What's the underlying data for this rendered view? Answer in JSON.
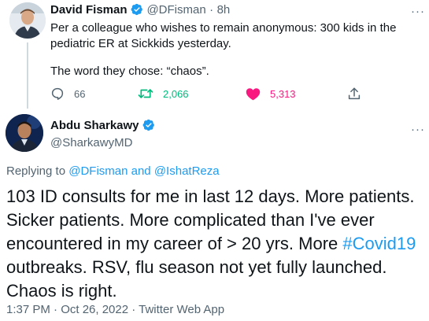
{
  "parent_tweet": {
    "display_name": "David Fisman",
    "handle": "@DFisman",
    "separator": "·",
    "time": "8h",
    "text_line1": "Per a colleague who wishes to remain anonymous: 300 kids in the pediatric ER at Sickkids yesterday.",
    "text_line2": "The word they chose: “chaos”.",
    "replies": "66",
    "retweets": "2,066",
    "likes": "5,313",
    "more": "···"
  },
  "main_tweet": {
    "display_name": "Abdu Sharkawy",
    "handle": "@SharkawyMD",
    "more": "···",
    "replying_prefix": "Replying to",
    "replying_user1": "@DFisman",
    "replying_and": "and",
    "replying_user2": "@IshatReza",
    "text_before_tag": "103 ID consults for me in last 12 days. More patients. Sicker patients. More complicated than I've ever encountered in my career of > 20 yrs. More",
    "hashtag": "#Covid19",
    "text_after_tag": "outbreaks.  RSV, flu season not yet fully launched. Chaos is right.",
    "timestamp": "1:37 PM · Oct 26, 2022 · Twitter Web App"
  },
  "icons": {
    "verified": "verified-badge-icon",
    "reply": "reply-icon",
    "retweet": "retweet-icon",
    "like": "heart-icon",
    "share": "share-icon",
    "more": "more-icon"
  },
  "colors": {
    "accent": "#1d9bf0",
    "retweet": "#00ba7c",
    "like": "#f91880",
    "muted": "#536471",
    "text": "#0f1419"
  }
}
